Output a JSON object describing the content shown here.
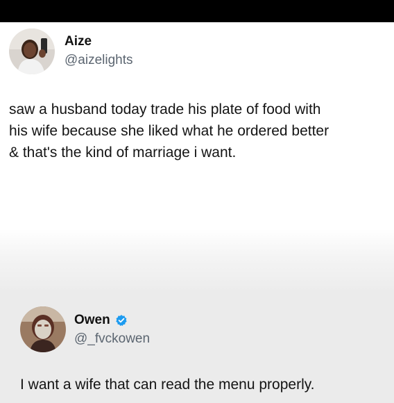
{
  "tweet1": {
    "name": "Aize",
    "handle": "@aizelights",
    "lines": [
      "saw a husband today trade his plate of food with",
      "his wife because she liked what he ordered better",
      "& that's the kind of marriage i want."
    ]
  },
  "tweet2": {
    "name": "Owen",
    "handle": "@_fvckowen",
    "verified_icon": "verified-badge-icon",
    "text": "I want a wife that can read the menu properly."
  },
  "colors": {
    "top_bar": "#000000",
    "verified": "#1d9bf0",
    "handle": "#5b6570"
  }
}
